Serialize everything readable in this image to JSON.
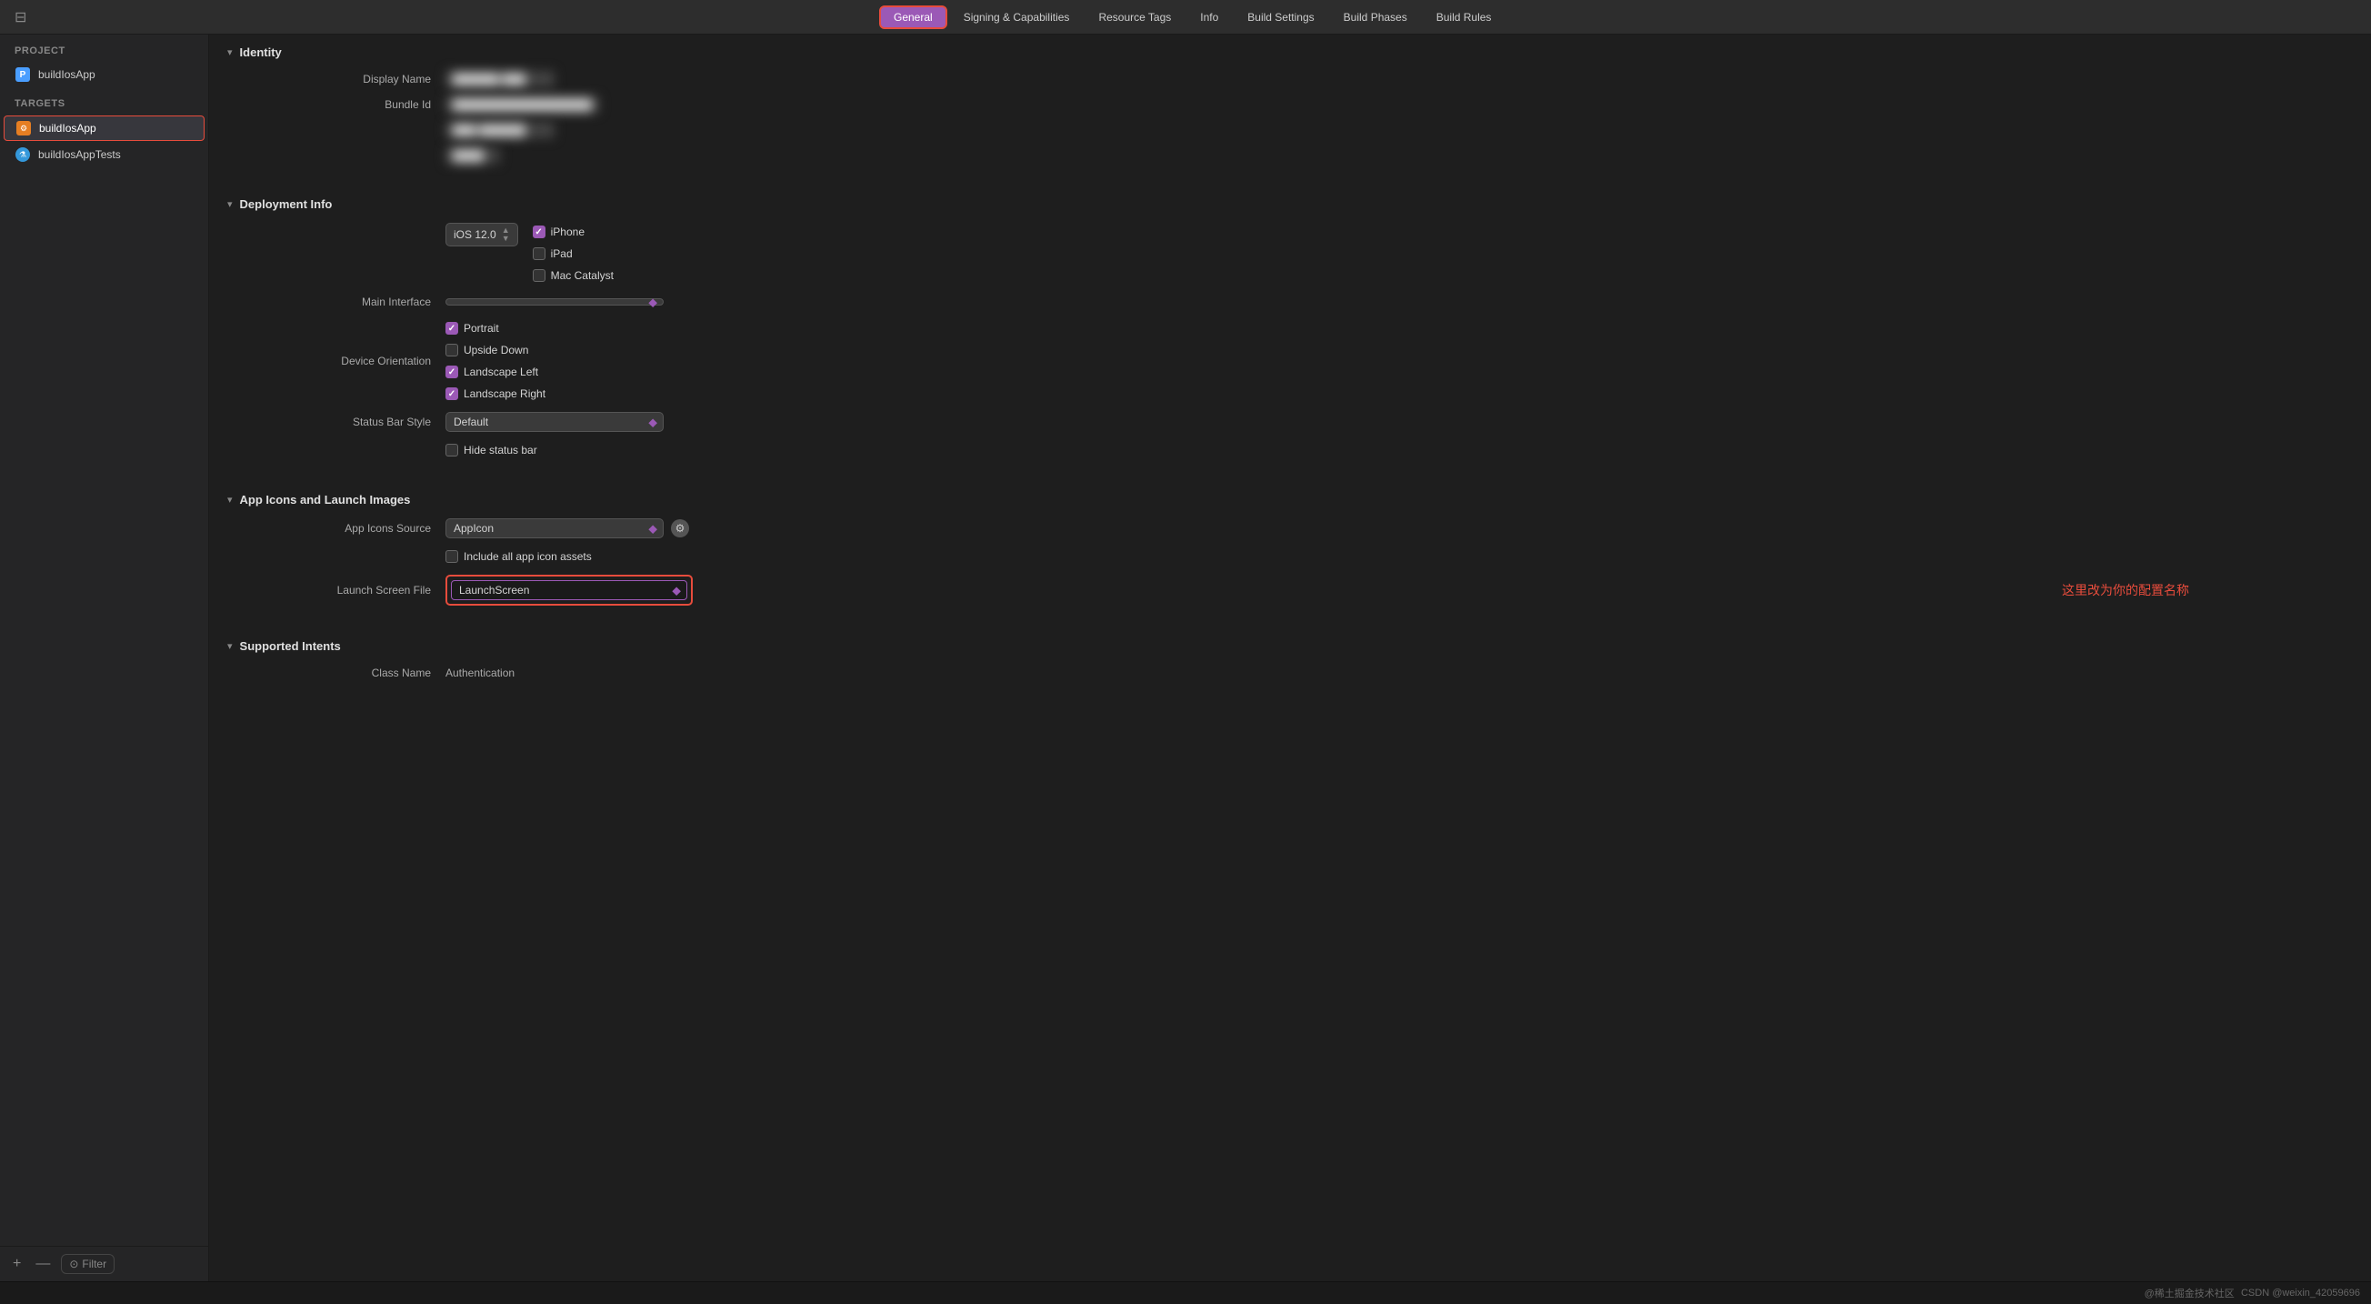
{
  "window": {
    "sidebar_toggle_icon": "⊟"
  },
  "tabs": [
    {
      "id": "general",
      "label": "General",
      "active": true
    },
    {
      "id": "signing",
      "label": "Signing & Capabilities",
      "active": false
    },
    {
      "id": "resource-tags",
      "label": "Resource Tags",
      "active": false
    },
    {
      "id": "info",
      "label": "Info",
      "active": false
    },
    {
      "id": "build-settings",
      "label": "Build Settings",
      "active": false
    },
    {
      "id": "build-phases",
      "label": "Build Phases",
      "active": false
    },
    {
      "id": "build-rules",
      "label": "Build Rules",
      "active": false
    }
  ],
  "sidebar": {
    "project_section": "PROJECT",
    "project_item": "buildIosApp",
    "targets_section": "TARGETS",
    "target_items": [
      {
        "id": "app",
        "label": "buildIosApp",
        "type": "app",
        "selected": true
      },
      {
        "id": "tests",
        "label": "buildIosAppTests",
        "type": "test"
      }
    ],
    "filter_placeholder": "Filter",
    "add_label": "+",
    "remove_label": "—"
  },
  "identity": {
    "section_title": "Identity",
    "display_name_label": "Display Name",
    "display_name_value": "██████ ███",
    "bundle_id_label": "Bundle Id",
    "bundle_id_value": "██████████████████",
    "version_label": "",
    "version_value": "███ ██████",
    "build_label": "",
    "build_value": "████"
  },
  "deployment": {
    "section_title": "Deployment Info",
    "ios_version_label": "iOS 12.0",
    "iphone_label": "iPhone",
    "ipad_label": "iPad",
    "mac_catalyst_label": "Mac Catalyst",
    "main_interface_label": "Main Interface",
    "main_interface_value": "",
    "device_orientation_label": "Device Orientation",
    "portrait_label": "Portrait",
    "portrait_checked": true,
    "upside_down_label": "Upside Down",
    "upside_down_checked": false,
    "landscape_left_label": "Landscape Left",
    "landscape_left_checked": true,
    "landscape_right_label": "Landscape Right",
    "landscape_right_checked": true,
    "status_bar_style_label": "Status Bar Style",
    "status_bar_style_value": "Default",
    "hide_status_bar_label": "Hide status bar",
    "hide_status_bar_checked": false
  },
  "app_icons": {
    "section_title": "App Icons and Launch Images",
    "app_icons_source_label": "App Icons Source",
    "app_icons_source_value": "AppIcon",
    "include_all_label": "Include all app icon assets",
    "include_all_checked": false,
    "launch_screen_file_label": "Launch Screen File",
    "launch_screen_file_value": "LaunchScreen",
    "annotation_text": "这里改为你的配置名称"
  },
  "supported_intents": {
    "section_title": "Supported Intents",
    "class_name_col": "Class Name",
    "authentication_col": "Authentication"
  },
  "bottom_bar": {
    "text1": "@稀土掘金技术社区",
    "text2": "CSDN @weixin_42059696"
  }
}
